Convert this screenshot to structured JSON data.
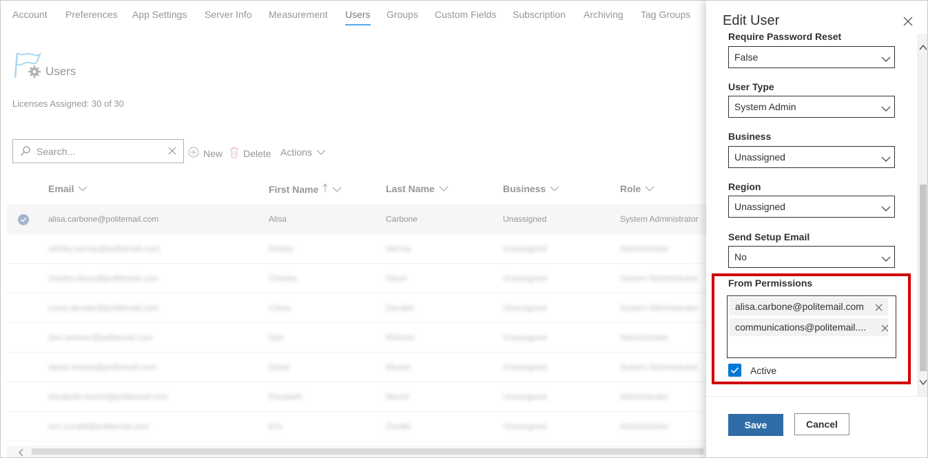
{
  "nav": {
    "tabs": [
      {
        "label": "Account"
      },
      {
        "label": "Preferences"
      },
      {
        "label": "App Settings"
      },
      {
        "label": "Server Info"
      },
      {
        "label": "Measurement"
      },
      {
        "label": "Users",
        "active": true
      },
      {
        "label": "Groups"
      },
      {
        "label": "Custom Fields"
      },
      {
        "label": "Subscription"
      },
      {
        "label": "Archiving"
      },
      {
        "label": "Tag Groups"
      }
    ]
  },
  "page": {
    "title": "Users",
    "licenses": "Licenses Assigned: 30 of 30"
  },
  "toolbar": {
    "search_placeholder": "Search...",
    "new_label": "New",
    "delete_label": "Delete",
    "actions_label": "Actions"
  },
  "table": {
    "columns": [
      "Email",
      "First Name",
      "Last Name",
      "Business",
      "Role"
    ],
    "rows": [
      {
        "email": "alisa.carbone@politemail.com",
        "first": "Alisa",
        "last": "Carbone",
        "business": "Unassigned",
        "role": "System Administrator",
        "selected": true
      },
      {
        "email": "ashley.varney@politemail.com",
        "first": "Ashley",
        "last": "Varney",
        "business": "Unassigned",
        "role": "Administrator"
      },
      {
        "email": "charles.dixon@politemail.com",
        "first": "Charles",
        "last": "Dixon",
        "business": "Unassigned",
        "role": "System Administrator"
      },
      {
        "email": "corey.devaler@politemail.com",
        "first": "Corey",
        "last": "Devaler",
        "business": "Unassigned",
        "role": "System Administrator"
      },
      {
        "email": "dan.wehner@politemail.com",
        "first": "Dan",
        "last": "Wehner",
        "business": "Unassigned",
        "role": "Administrator"
      },
      {
        "email": "david.mease@politemail.com",
        "first": "David",
        "last": "Mease",
        "business": "Unassigned",
        "role": "System Administrator"
      },
      {
        "email": "elizabeth.merrel@politemail.com",
        "first": "Elizabeth",
        "last": "Merrel",
        "business": "Unassigned",
        "role": "Administrator"
      },
      {
        "email": "eric.zurakil@politemail.com",
        "first": "Eric",
        "last": "Zurakil",
        "business": "Unassigned",
        "role": "Administrator"
      }
    ]
  },
  "panel": {
    "title": "Edit User",
    "fields": [
      {
        "label": "Require Password Reset",
        "value": "False"
      },
      {
        "label": "User Type",
        "value": "System Admin"
      },
      {
        "label": "Business",
        "value": "Unassigned"
      },
      {
        "label": "Region",
        "value": "Unassigned"
      },
      {
        "label": "Send Setup Email",
        "value": "No"
      }
    ],
    "from_permissions": {
      "label": "From Permissions",
      "tags": [
        "alisa.carbone@politemail.com",
        "communications@politemail...."
      ]
    },
    "active_label": "Active",
    "active_checked": true,
    "save_label": "Save",
    "cancel_label": "Cancel"
  },
  "colors": {
    "accent": "#0078d4",
    "save_button": "#2f6ca8",
    "highlight": "#d00000"
  }
}
